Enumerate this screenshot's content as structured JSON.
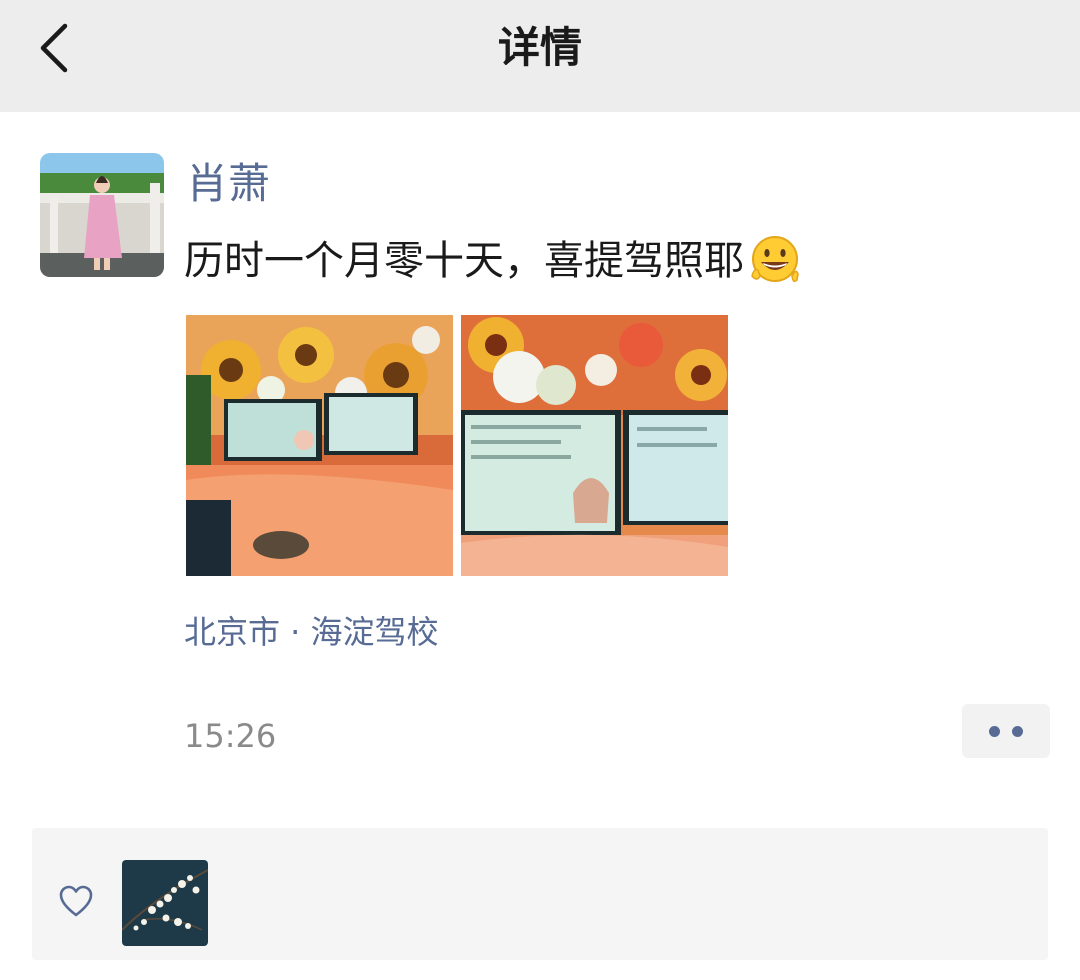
{
  "header": {
    "title": "详情",
    "back_icon": "chevron-left-icon"
  },
  "post": {
    "author": "肖萧",
    "text": "历时一个月零十天，喜提驾照耶",
    "emoji": "grinning-peace-emoji",
    "photos": [
      "driver-license-bouquet-photo-1",
      "driver-license-bouquet-photo-2"
    ],
    "location": "北京市 · 海淀驾校",
    "time": "15:26"
  },
  "likes": {
    "icon": "heart-icon",
    "likers": [
      "plum-blossom-avatar"
    ]
  },
  "colors": {
    "link": "#576b95",
    "header_bg": "#ededed",
    "panel_bg": "#f5f5f5",
    "time": "#8a8a8a"
  }
}
